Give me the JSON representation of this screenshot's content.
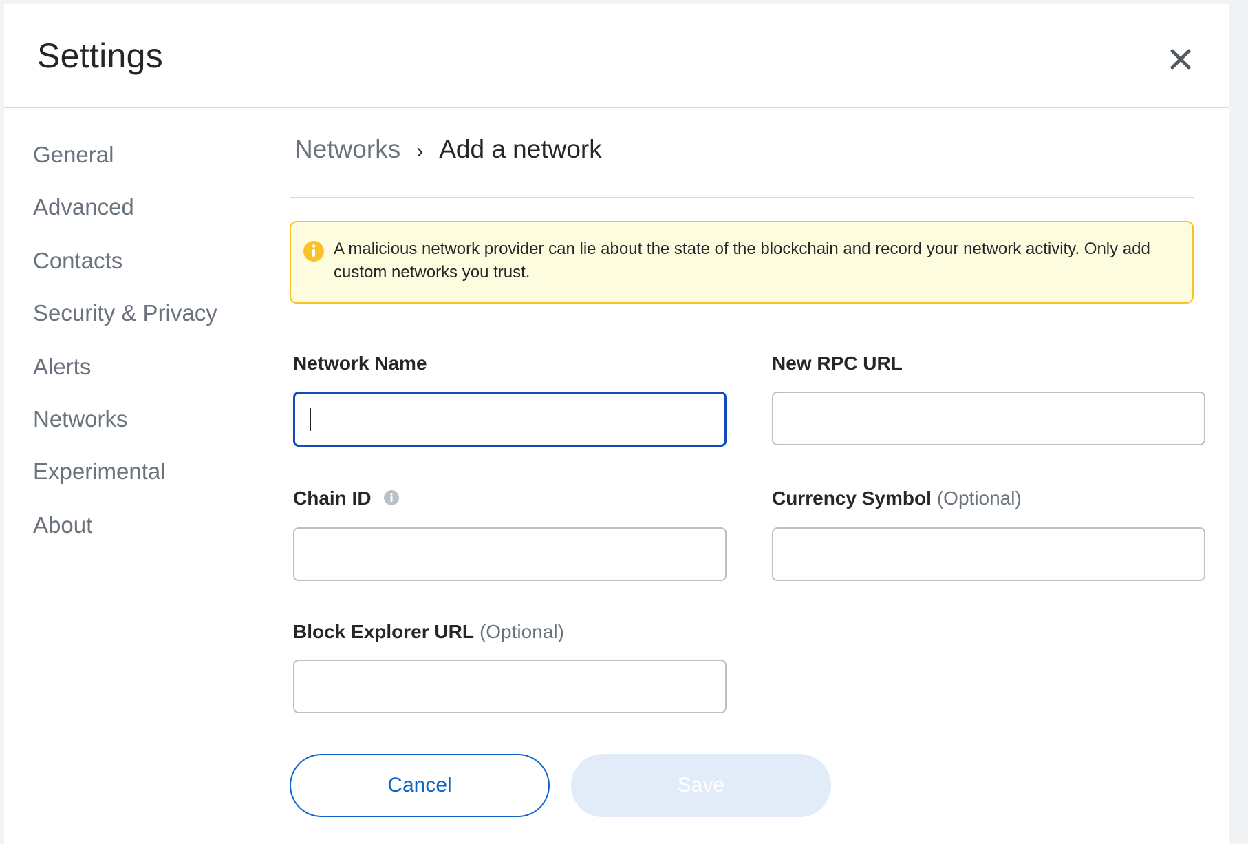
{
  "header": {
    "title": "Settings",
    "close_icon": "close-icon"
  },
  "sidebar": {
    "items": [
      {
        "label": "General"
      },
      {
        "label": "Advanced"
      },
      {
        "label": "Contacts"
      },
      {
        "label": "Security & Privacy"
      },
      {
        "label": "Alerts"
      },
      {
        "label": "Networks"
      },
      {
        "label": "Experimental"
      },
      {
        "label": "About"
      }
    ]
  },
  "breadcrumb": {
    "parent": "Networks",
    "separator": "›",
    "current": "Add a network"
  },
  "warning": {
    "icon": "info-circle-icon",
    "text": "A malicious network provider can lie about the state of the blockchain and record your network activity. Only add custom networks you trust."
  },
  "form": {
    "network_name": {
      "label": "Network Name",
      "value": ""
    },
    "rpc_url": {
      "label": "New RPC URL",
      "value": ""
    },
    "chain_id": {
      "label": "Chain ID",
      "value": "",
      "info_icon": "info-icon"
    },
    "currency_symbol": {
      "label": "Currency Symbol",
      "optional": "(Optional)",
      "value": ""
    },
    "block_explorer": {
      "label": "Block Explorer URL",
      "optional": "(Optional)",
      "value": ""
    }
  },
  "buttons": {
    "cancel": "Cancel",
    "save": "Save"
  },
  "colors": {
    "primary": "#0f63c9",
    "focus_border": "#0f4bbd",
    "warning_bg": "#fefcde",
    "warning_border": "#f8c22b",
    "save_disabled_bg": "#e1ecf8"
  }
}
